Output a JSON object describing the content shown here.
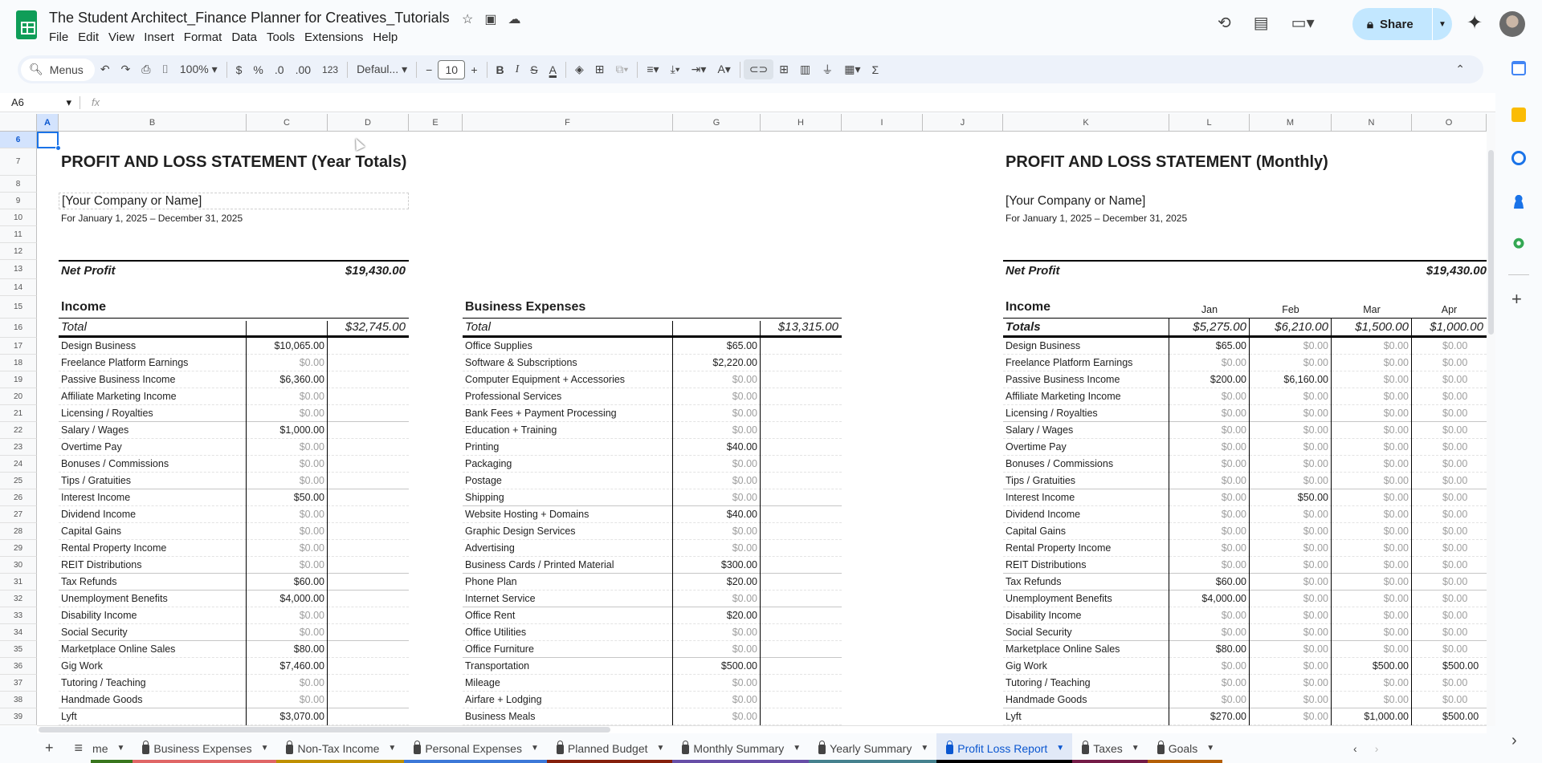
{
  "app": {
    "title": "The Student Architect_Finance Planner for Creatives_Tutorials",
    "menu": [
      "File",
      "Edit",
      "View",
      "Insert",
      "Format",
      "Data",
      "Tools",
      "Extensions",
      "Help"
    ],
    "share_label": "Share"
  },
  "toolbar": {
    "menus": "Menus",
    "zoom": "100%",
    "currency": "$",
    "percent": "%",
    "dec_dec": ".0",
    "dec_inc": ".00",
    "format_123": "123",
    "font": "Defaul...",
    "font_size": "10"
  },
  "formula_bar": {
    "cell_ref": "A6",
    "fx": "fx",
    "value": ""
  },
  "columns": [
    "A",
    "B",
    "C",
    "D",
    "E",
    "F",
    "G",
    "H",
    "I",
    "J",
    "K",
    "L",
    "M",
    "N",
    "O"
  ],
  "rows": [
    6,
    7,
    8,
    9,
    10,
    11,
    12,
    13,
    14,
    15,
    16,
    17,
    18,
    19,
    20,
    21,
    22,
    23,
    24,
    25,
    26,
    27,
    28,
    29,
    30,
    31,
    32,
    33,
    34,
    35,
    36,
    37,
    38,
    39
  ],
  "year": {
    "title": "PROFIT AND LOSS STATEMENT (Year Totals)",
    "company": "[Your Company or Name]",
    "period": "For January 1, 2025 – December 31, 2025",
    "net_profit_label": "Net Profit",
    "net_profit": "$19,430.00",
    "income_label": "Income",
    "total_label": "Total",
    "income_total": "$32,745.00",
    "expenses_label": "Business Expenses",
    "expenses_total": "$13,315.00"
  },
  "monthly": {
    "title": "PROFIT AND LOSS STATEMENT (Monthly)",
    "company": "[Your Company or Name]",
    "period": "For January 1, 2025 – December 31, 2025",
    "net_profit_label": "Net Profit",
    "net_profit": "$19,430.00",
    "income_label": "Income",
    "totals_label": "Totals",
    "months": [
      "Jan",
      "Feb",
      "Mar",
      "Apr"
    ],
    "month_totals": [
      "$5,275.00",
      "$6,210.00",
      "$1,500.00",
      "$1,000.00"
    ]
  },
  "income": [
    {
      "name": "Design Business",
      "total": "$10,065.00",
      "m": [
        "$65.00",
        "$0.00",
        "$0.00",
        "$0.00"
      ]
    },
    {
      "name": "Freelance Platform Earnings",
      "total": "$0.00",
      "m": [
        "$0.00",
        "$0.00",
        "$0.00",
        "$0.00"
      ]
    },
    {
      "name": "Passive Business Income",
      "total": "$6,360.00",
      "m": [
        "$200.00",
        "$6,160.00",
        "$0.00",
        "$0.00"
      ]
    },
    {
      "name": "Affiliate Marketing Income",
      "total": "$0.00",
      "m": [
        "$0.00",
        "$0.00",
        "$0.00",
        "$0.00"
      ]
    },
    {
      "name": "Licensing / Royalties",
      "total": "$0.00",
      "m": [
        "$0.00",
        "$0.00",
        "$0.00",
        "$0.00"
      ]
    },
    {
      "name": "Salary / Wages",
      "total": "$1,000.00",
      "m": [
        "$0.00",
        "$0.00",
        "$0.00",
        "$0.00"
      ]
    },
    {
      "name": "Overtime Pay",
      "total": "$0.00",
      "m": [
        "$0.00",
        "$0.00",
        "$0.00",
        "$0.00"
      ]
    },
    {
      "name": "Bonuses / Commissions",
      "total": "$0.00",
      "m": [
        "$0.00",
        "$0.00",
        "$0.00",
        "$0.00"
      ]
    },
    {
      "name": "Tips / Gratuities",
      "total": "$0.00",
      "m": [
        "$0.00",
        "$0.00",
        "$0.00",
        "$0.00"
      ]
    },
    {
      "name": "Interest Income",
      "total": "$50.00",
      "m": [
        "$0.00",
        "$50.00",
        "$0.00",
        "$0.00"
      ]
    },
    {
      "name": "Dividend Income",
      "total": "$0.00",
      "m": [
        "$0.00",
        "$0.00",
        "$0.00",
        "$0.00"
      ]
    },
    {
      "name": "Capital Gains",
      "total": "$0.00",
      "m": [
        "$0.00",
        "$0.00",
        "$0.00",
        "$0.00"
      ]
    },
    {
      "name": "Rental Property Income",
      "total": "$0.00",
      "m": [
        "$0.00",
        "$0.00",
        "$0.00",
        "$0.00"
      ]
    },
    {
      "name": "REIT Distributions",
      "total": "$0.00",
      "m": [
        "$0.00",
        "$0.00",
        "$0.00",
        "$0.00"
      ]
    },
    {
      "name": "Tax Refunds",
      "total": "$60.00",
      "m": [
        "$60.00",
        "$0.00",
        "$0.00",
        "$0.00"
      ]
    },
    {
      "name": "Unemployment Benefits",
      "total": "$4,000.00",
      "m": [
        "$4,000.00",
        "$0.00",
        "$0.00",
        "$0.00"
      ]
    },
    {
      "name": "Disability Income",
      "total": "$0.00",
      "m": [
        "$0.00",
        "$0.00",
        "$0.00",
        "$0.00"
      ]
    },
    {
      "name": "Social Security",
      "total": "$0.00",
      "m": [
        "$0.00",
        "$0.00",
        "$0.00",
        "$0.00"
      ]
    },
    {
      "name": "Marketplace Online Sales",
      "total": "$80.00",
      "m": [
        "$80.00",
        "$0.00",
        "$0.00",
        "$0.00"
      ]
    },
    {
      "name": "Gig Work",
      "total": "$7,460.00",
      "m": [
        "$0.00",
        "$0.00",
        "$500.00",
        "$500.00"
      ]
    },
    {
      "name": "Tutoring / Teaching",
      "total": "$0.00",
      "m": [
        "$0.00",
        "$0.00",
        "$0.00",
        "$0.00"
      ]
    },
    {
      "name": "Handmade Goods",
      "total": "$0.00",
      "m": [
        "$0.00",
        "$0.00",
        "$0.00",
        "$0.00"
      ]
    },
    {
      "name": "Lyft",
      "total": "$3,070.00",
      "m": [
        "$270.00",
        "$0.00",
        "$1,000.00",
        "$500.00"
      ]
    }
  ],
  "expenses": [
    {
      "name": "Office Supplies",
      "total": "$65.00"
    },
    {
      "name": "Software & Subscriptions",
      "total": "$2,220.00"
    },
    {
      "name": "Computer Equipment + Accessories",
      "total": "$0.00"
    },
    {
      "name": "Professional Services",
      "total": "$0.00"
    },
    {
      "name": "Bank Fees + Payment Processing",
      "total": "$0.00"
    },
    {
      "name": "Education + Training",
      "total": "$0.00"
    },
    {
      "name": "Printing",
      "total": "$40.00"
    },
    {
      "name": "Packaging",
      "total": "$0.00"
    },
    {
      "name": "Postage",
      "total": "$0.00"
    },
    {
      "name": "Shipping",
      "total": "$0.00"
    },
    {
      "name": "Website Hosting + Domains",
      "total": "$40.00"
    },
    {
      "name": "Graphic Design Services",
      "total": "$0.00"
    },
    {
      "name": "Advertising",
      "total": "$0.00"
    },
    {
      "name": "Business Cards / Printed Material",
      "total": "$300.00"
    },
    {
      "name": "Phone Plan",
      "total": "$20.00"
    },
    {
      "name": "Internet Service",
      "total": "$0.00"
    },
    {
      "name": "Office Rent",
      "total": "$20.00"
    },
    {
      "name": "Office Utilities",
      "total": "$0.00"
    },
    {
      "name": "Office Furniture",
      "total": "$0.00"
    },
    {
      "name": "Transportation",
      "total": "$500.00"
    },
    {
      "name": "Mileage",
      "total": "$0.00"
    },
    {
      "name": "Airfare + Lodging",
      "total": "$0.00"
    },
    {
      "name": "Business Meals",
      "total": "$0.00"
    }
  ],
  "sheet_tabs": [
    {
      "label": "me",
      "color": "#38761d",
      "locked": false
    },
    {
      "label": "Business Expenses",
      "color": "#e06666",
      "locked": true
    },
    {
      "label": "Non-Tax Income",
      "color": "#bf9000",
      "locked": true
    },
    {
      "label": "Personal Expenses",
      "color": "#3c78d8",
      "locked": true
    },
    {
      "label": "Planned Budget",
      "color": "#85200c",
      "locked": true
    },
    {
      "label": "Monthly Summary",
      "color": "#674ea7",
      "locked": true
    },
    {
      "label": "Yearly Summary",
      "color": "#45818e",
      "locked": true
    },
    {
      "label": "Profit Loss Report",
      "color": "#000000",
      "locked": true,
      "active": true
    },
    {
      "label": "Taxes",
      "color": "#741b47",
      "locked": true
    },
    {
      "label": "Goals",
      "color": "#b45f06",
      "locked": true
    }
  ]
}
